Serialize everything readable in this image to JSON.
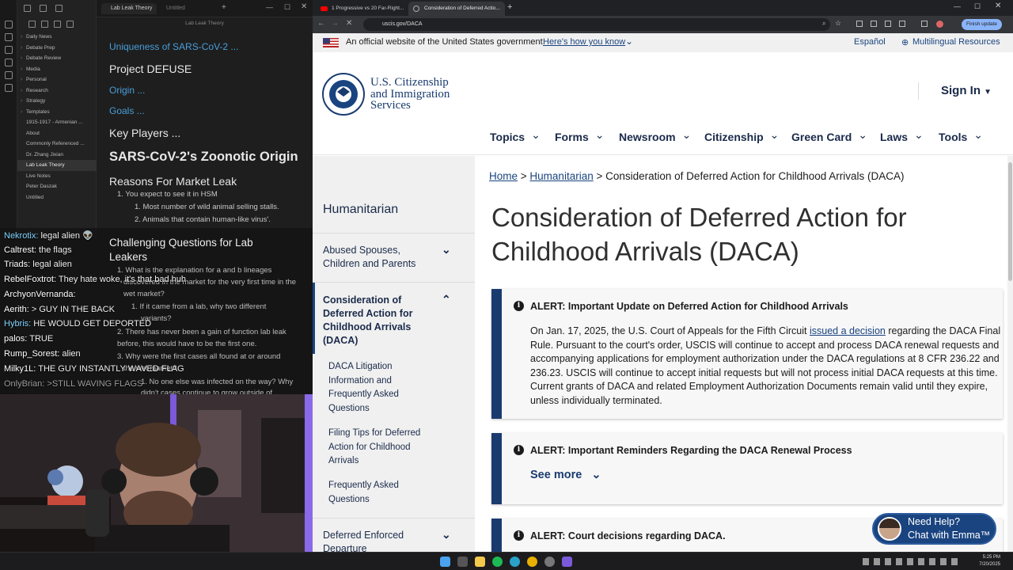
{
  "obsidian": {
    "tabs": [
      "Lab Leak Theory",
      "Untitled"
    ],
    "titlebar": "Lab Leak Theory",
    "file_tree": [
      {
        "label": "Daily News",
        "folder": true
      },
      {
        "label": "Debate Prep",
        "folder": true
      },
      {
        "label": "Debate Review",
        "folder": true
      },
      {
        "label": "Media",
        "folder": true
      },
      {
        "label": "Personal",
        "folder": true
      },
      {
        "label": "Research",
        "folder": true
      },
      {
        "label": "Strategy",
        "folder": true
      },
      {
        "label": "Templates",
        "folder": true
      },
      {
        "label": "1915-1917 - Armenian ...",
        "folder": false
      },
      {
        "label": "About",
        "folder": false
      },
      {
        "label": "Commonly Referenced ...",
        "folder": false
      },
      {
        "label": "Dr. Zhang Jixian",
        "folder": false
      },
      {
        "label": "Lab Leak Theory",
        "folder": false,
        "active": true
      },
      {
        "label": "Live Notes",
        "folder": false
      },
      {
        "label": "Peter Daszak",
        "folder": false
      },
      {
        "label": "Untitled",
        "folder": false
      }
    ],
    "note": {
      "uniqueness": "Uniqueness of SARS-CoV-2 ...",
      "defuse": "Project DEFUSE",
      "origin": "Origin ...",
      "goals": "Goals ...",
      "key_players": "Key Players ...",
      "zoonotic": "SARS-CoV-2's Zoonotic Origin",
      "market_leak": "Reasons For Market Leak",
      "ml_1": "1.  You expect to see it in HSM",
      "ml_1a": "1.  Most number of wild animal selling stalls.",
      "ml_1b": "2.  Animals that contain human-like virus'.",
      "challenging": "Challenging Questions for Lab",
      "leakers": "Leakers",
      "q1": "1.  What is the explanation for a and b lineages",
      "q1b": "discovered in the market for the very first time in the",
      "q1c": "wet market?",
      "q1d": "1.  If it came from a lab, why two different",
      "q1e": "variants?",
      "q2": "2.  There has never been a gain of function lab leak",
      "q2b": "before, this would have to be the first one.",
      "q3": "3.  Why were the first cases all found at or around",
      "q3b": "the wet market?",
      "q3c": "1.  No one else was infected on the way? Why",
      "q3d": "didn't cases continue to grow outside of"
    }
  },
  "chat": [
    {
      "user": "Nekrotix",
      "color": "#7fd4ff",
      "msg": "legal alien 👽"
    },
    {
      "user": "Caltrest",
      "color": "#ffffff",
      "msg": "the flags"
    },
    {
      "user": "Triads",
      "color": "#ffffff",
      "msg": "legal alien"
    },
    {
      "user": "RebelFoxtrot",
      "color": "#ffffff",
      "msg": "They hate woke, it's that bad huh"
    },
    {
      "user": "ArchyonVernanda",
      "color": "#ffffff",
      "msg": ""
    },
    {
      "user": "Aerith",
      "color": "#ffffff",
      "msg": "> GUY IN THE BACK"
    },
    {
      "user": "Hybris",
      "color": "#7fd4ff",
      "msg": "HE WOULD GET DEPORTED"
    },
    {
      "user": "palos",
      "color": "#ffffff",
      "msg": "TRUE"
    },
    {
      "user": "Rump_Sorest",
      "color": "#ffffff",
      "msg": "alien"
    },
    {
      "user": "Milky1L",
      "color": "#ffffff",
      "msg": "THE GUY INSTANTLY WAVED FLAG"
    },
    {
      "user": "OnlyBrian",
      "color": "#9a9a9a",
      "msg": ">STILL WAVING FLAGS"
    }
  ],
  "browser": {
    "tabs": [
      "1 Progressive vs 20 Far-Right...",
      "Consideration of Deferred Actio..."
    ],
    "url": "uscis.gov/DACA",
    "finish_update": "Finish update",
    "gov_banner": "An official website of the United States government",
    "heres_how": "Here's how you know",
    "espanol": "Español",
    "multilingual": "Multilingual Resources",
    "logo_line1": "U.S. Citizenship",
    "logo_line2": "and Immigration",
    "logo_line3": "Services",
    "sign_in": "Sign In",
    "nav": [
      "Topics",
      "Forms",
      "Newsroom",
      "Citizenship",
      "Green Card",
      "Laws",
      "Tools"
    ],
    "breadcrumb": {
      "home": "Home",
      "humanitarian": "Humanitarian",
      "current": "Consideration of Deferred Action for Childhood Arrivals (DACA)"
    },
    "sidenav": {
      "title": "Humanitarian",
      "abused": "Abused Spouses, Children and Parents",
      "daca": "Consideration of Deferred Action for Childhood Arrivals (DACA)",
      "sub1": "DACA Litigation Information and Frequently Asked Questions",
      "sub2": "Filing Tips for Deferred Action for Childhood Arrivals",
      "sub3": "Frequently Asked Questions",
      "ded": "Deferred Enforced Departure"
    },
    "page_title": "Consideration of Deferred Action for Childhood Arrivals (DACA)",
    "alert1_title": "ALERT: Important Update on Deferred Action for Childhood Arrivals",
    "alert1_pre": "On Jan. 17, 2025, the U.S. Court of Appeals for the Fifth Circuit ",
    "alert1_link": "issued a decision",
    "alert1_post": " regarding the DACA Final Rule. Pursuant to the court's order, USCIS will continue to accept and process DACA renewal requests and accompanying applications for employment authorization under the DACA regulations at 8 CFR 236.22 and 236.23. USCIS will continue to accept initial requests but will not process initial DACA requests at this time. Current grants of DACA and related Employment Authorization Documents remain valid until they expire, unless individually terminated.",
    "alert2_title": "ALERT: Important Reminders Regarding the DACA Renewal Process",
    "see_more": "See more",
    "alert3_title": "ALERT: Court decisions regarding DACA.",
    "emma_line1": "Need Help?",
    "emma_line2": "Chat with Emma™"
  },
  "taskbar": {
    "time": "5:25 PM",
    "date": "7/20/2025"
  }
}
